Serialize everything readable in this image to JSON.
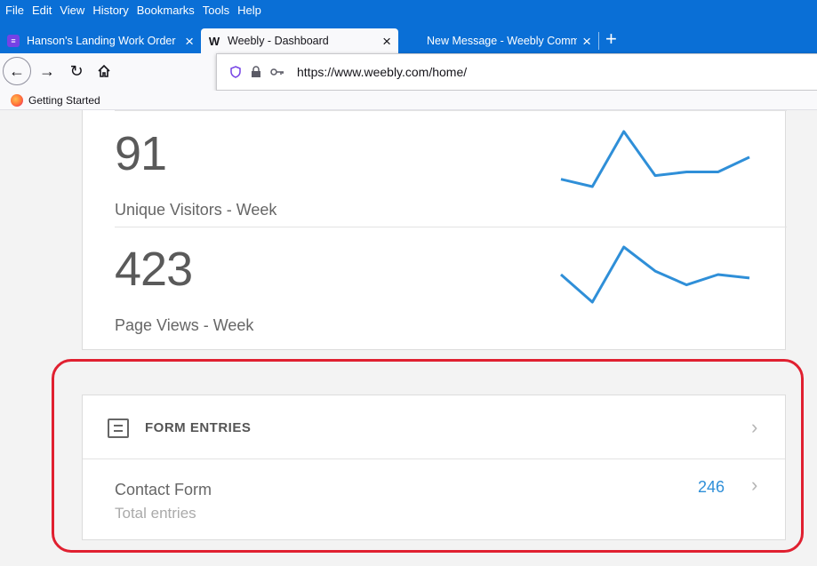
{
  "menu": [
    "File",
    "Edit",
    "View",
    "History",
    "Bookmarks",
    "Tools",
    "Help"
  ],
  "tabs": [
    {
      "label": "Hanson's Landing Work Order",
      "active": false,
      "icon": "list-icon"
    },
    {
      "label": "Weebly - Dashboard",
      "active": true,
      "icon": "weebly-icon"
    },
    {
      "label": "New Message - Weebly Comm",
      "active": false,
      "icon": ""
    }
  ],
  "url": "https://www.weebly.com/home/",
  "bookmarks": [
    {
      "label": "Getting Started",
      "icon": "firefox-icon"
    }
  ],
  "stats": [
    {
      "value": "91",
      "label": "Unique Visitors - Week",
      "spark": [
        5,
        3,
        18,
        6,
        7,
        7,
        11
      ]
    },
    {
      "value": "423",
      "label": "Page Views - Week",
      "spark": [
        10,
        2,
        18,
        11,
        7,
        10,
        9
      ]
    }
  ],
  "forms": {
    "title": "FORM ENTRIES",
    "entries": [
      {
        "name": "Contact Form",
        "subtitle": "Total entries",
        "count": "246"
      }
    ]
  },
  "colors": {
    "accent": "#2f8fd8",
    "chrome": "#0a6fd6",
    "highlight": "#e02030"
  }
}
